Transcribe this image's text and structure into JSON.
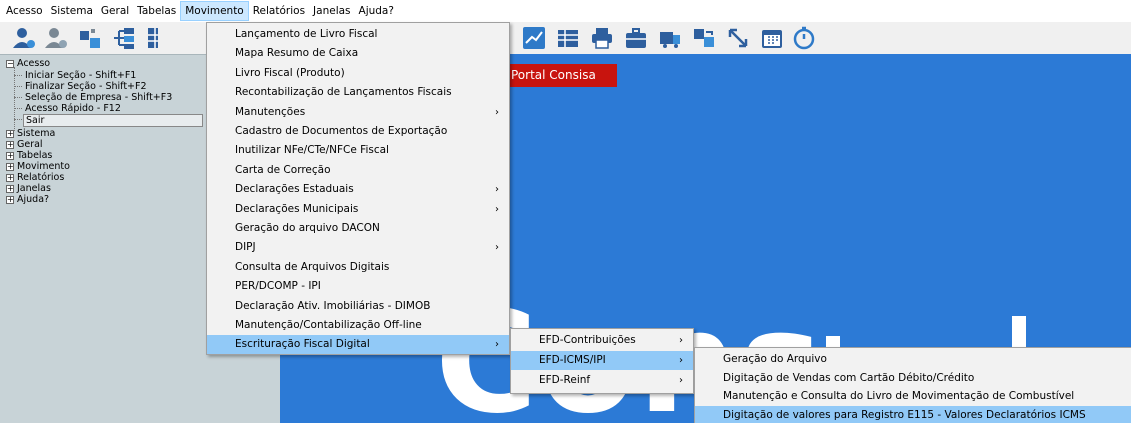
{
  "menubar": [
    "Acesso",
    "Sistema",
    "Geral",
    "Tabelas",
    "Movimento",
    "Relatórios",
    "Janelas",
    "Ajuda?"
  ],
  "toolbar_icons": [
    "user-login-icon",
    "user-logout-icon",
    "company-icon",
    "network-icon",
    "grid-icon",
    "chart-icon",
    "spreadsheet-icon",
    "printer-icon",
    "briefcase-icon",
    "delivery-icon",
    "transfer-icon",
    "resize-icon",
    "calendar-icon",
    "timer-icon"
  ],
  "tree": {
    "acesso": "Acesso",
    "acesso_children": [
      "Iniciar Seção - Shift+F1",
      "Finalizar Seção - Shift+F2",
      "Seleção de Empresa - Shift+F3",
      "Acesso Rápido - F12",
      "Sair"
    ],
    "others": [
      "Sistema",
      "Geral",
      "Tabelas",
      "Movimento",
      "Relatórios",
      "Janelas",
      "Ajuda?"
    ],
    "expanded_symbol": "−",
    "collapsed_symbol": "+"
  },
  "portal_tab": "Portal Consisa",
  "background_text": "Cons",
  "movimento_menu": [
    {
      "label": "Lançamento de Livro Fiscal",
      "sub": false
    },
    {
      "label": "Mapa Resumo de Caixa",
      "sub": false
    },
    {
      "label": "Livro Fiscal (Produto)",
      "sub": false
    },
    {
      "label": "Recontabilização de Lançamentos Fiscais",
      "sub": false
    },
    {
      "label": "Manutenções",
      "sub": true
    },
    {
      "label": "Cadastro de Documentos de Exportação",
      "sub": false
    },
    {
      "label": "Inutilizar NFe/CTe/NFCe Fiscal",
      "sub": false
    },
    {
      "label": "Carta de Correção",
      "sub": false
    },
    {
      "label": "Declarações Estaduais",
      "sub": true
    },
    {
      "label": "Declarações Municipais",
      "sub": true
    },
    {
      "label": "Geração do arquivo DACON",
      "sub": false
    },
    {
      "label": "DIPJ",
      "sub": true
    },
    {
      "label": "Consulta de Arquivos Digitais",
      "sub": false
    },
    {
      "label": "PER/DCOMP - IPI",
      "sub": false
    },
    {
      "label": "Declaração Ativ. Imobiliárias - DIMOB",
      "sub": false
    },
    {
      "label": "Manutenção/Contabilização Off-line",
      "sub": false
    },
    {
      "label": "Escrituração Fiscal Digital",
      "sub": true
    }
  ],
  "efd_menu": [
    {
      "label": "EFD-Contribuições",
      "sub": true
    },
    {
      "label": "EFD-ICMS/IPI",
      "sub": true
    },
    {
      "label": "EFD-Reinf",
      "sub": true
    }
  ],
  "icms_menu": [
    {
      "label": "Geração do Arquivo"
    },
    {
      "label": "Digitação de Vendas com Cartão Débito/Crédito"
    },
    {
      "label": "Manutenção e Consulta do Livro de Movimentação de Combustível"
    },
    {
      "label": "Digitação de valores para Registro E115 - Valores Declaratórios ICMS"
    }
  ],
  "submenu_arrow": "›",
  "colors": {
    "accent_blue": "#2c7ad6",
    "portal_red": "#c8140e",
    "highlight": "#91c9f7",
    "tree_bg": "#c8d3d7"
  }
}
